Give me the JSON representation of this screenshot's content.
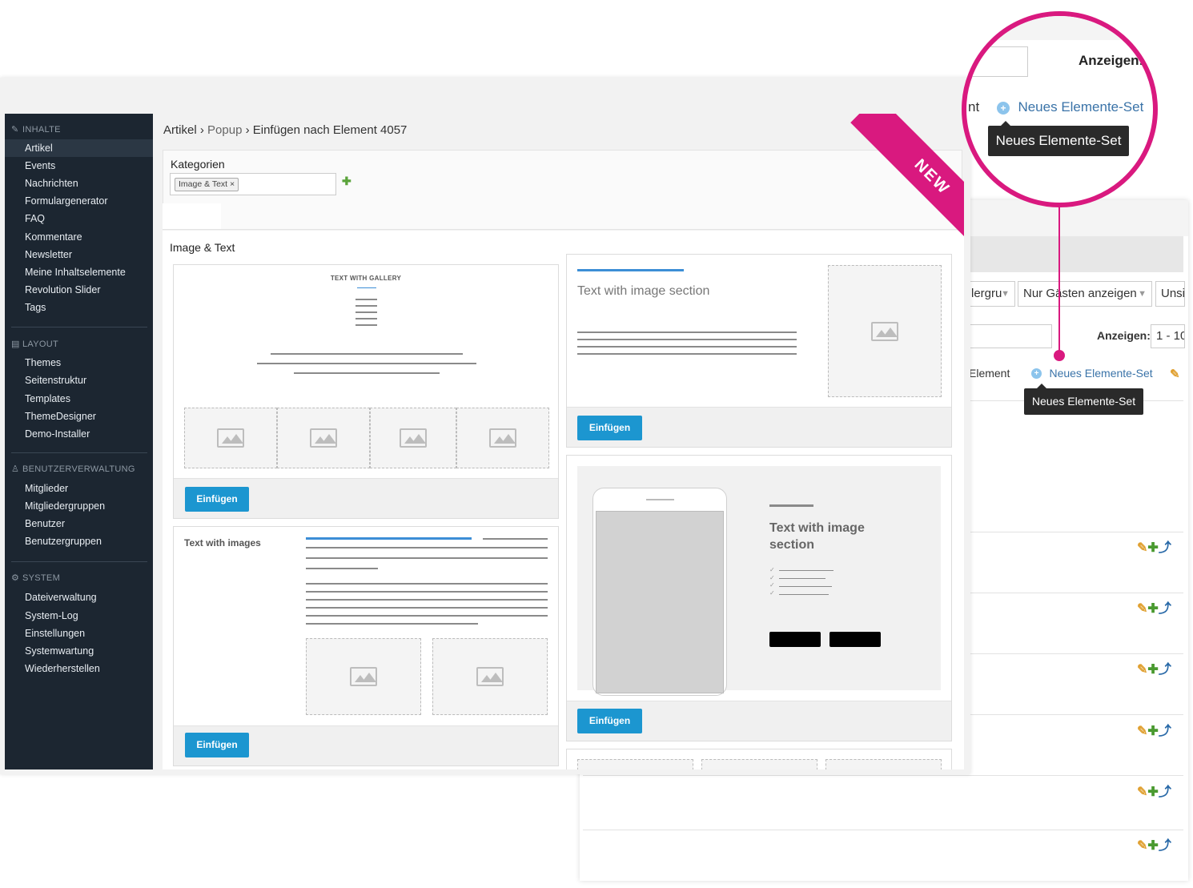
{
  "sidebar": {
    "sections": [
      {
        "title": "INHALTE",
        "icon": "edit-icon",
        "items": [
          "Artikel",
          "Events",
          "Nachrichten",
          "Formulargenerator",
          "FAQ",
          "Kommentare",
          "Newsletter",
          "Meine Inhaltselemente",
          "Revolution Slider",
          "Tags"
        ]
      },
      {
        "title": "LAYOUT",
        "icon": "layout-icon",
        "items": [
          "Themes",
          "Seitenstruktur",
          "Templates",
          "ThemeDesigner",
          "Demo-Installer"
        ]
      },
      {
        "title": "BENUTZERVERWALTUNG",
        "icon": "user-icon",
        "items": [
          "Mitglieder",
          "Mitgliedergruppen",
          "Benutzer",
          "Benutzergruppen"
        ]
      },
      {
        "title": "SYSTEM",
        "icon": "gear-icon",
        "items": [
          "Dateiverwaltung",
          "System-Log",
          "Einstellungen",
          "Systemwartung",
          "Wiederherstellen"
        ]
      }
    ],
    "active_item": "Artikel"
  },
  "breadcrumb": {
    "first": "Artikel",
    "sep1": "›",
    "second": "Popup",
    "sep2": "›",
    "third": "Einfügen nach Element 4057"
  },
  "categories": {
    "label": "Kategorien",
    "tag": "Image & Text",
    "tag_remove": "×",
    "add_icon": "add-category-icon"
  },
  "section_title": "Image & Text",
  "cards": {
    "gallery": {
      "heading": "TEXT WITH GALLERY",
      "button": "Einfügen"
    },
    "image_section": {
      "heading": "Text with image section",
      "button": "Einfügen"
    },
    "text_images": {
      "heading": "Text with images",
      "button": "Einfügen"
    },
    "phone_section": {
      "heading": "Text with image section",
      "button": "Einfügen"
    }
  },
  "ribbon": {
    "label": "NEW",
    "color": "#d9197f"
  },
  "magnifier": {
    "anzeigen": "Anzeigen:",
    "element_partial": "nt",
    "link": "Neues Elemente-Set",
    "tooltip": "Neues Elemente-Set"
  },
  "background_window": {
    "filters": [
      "lergru",
      "Nur Gästen anzeigen",
      "Unsi"
    ],
    "anzeigen_label": "Anzeigen:",
    "anzeigen_value": "1 - 10",
    "element_partial": "Element",
    "link": "Neues Elemente-Set",
    "tooltip": "Neues Elemente-Set",
    "row_actions": [
      "pencil-icon",
      "plus-icon",
      "arrow-icon"
    ]
  },
  "colors": {
    "accent": "#1c96d0",
    "highlight": "#d9197f",
    "sidebar": "#1c2631"
  }
}
